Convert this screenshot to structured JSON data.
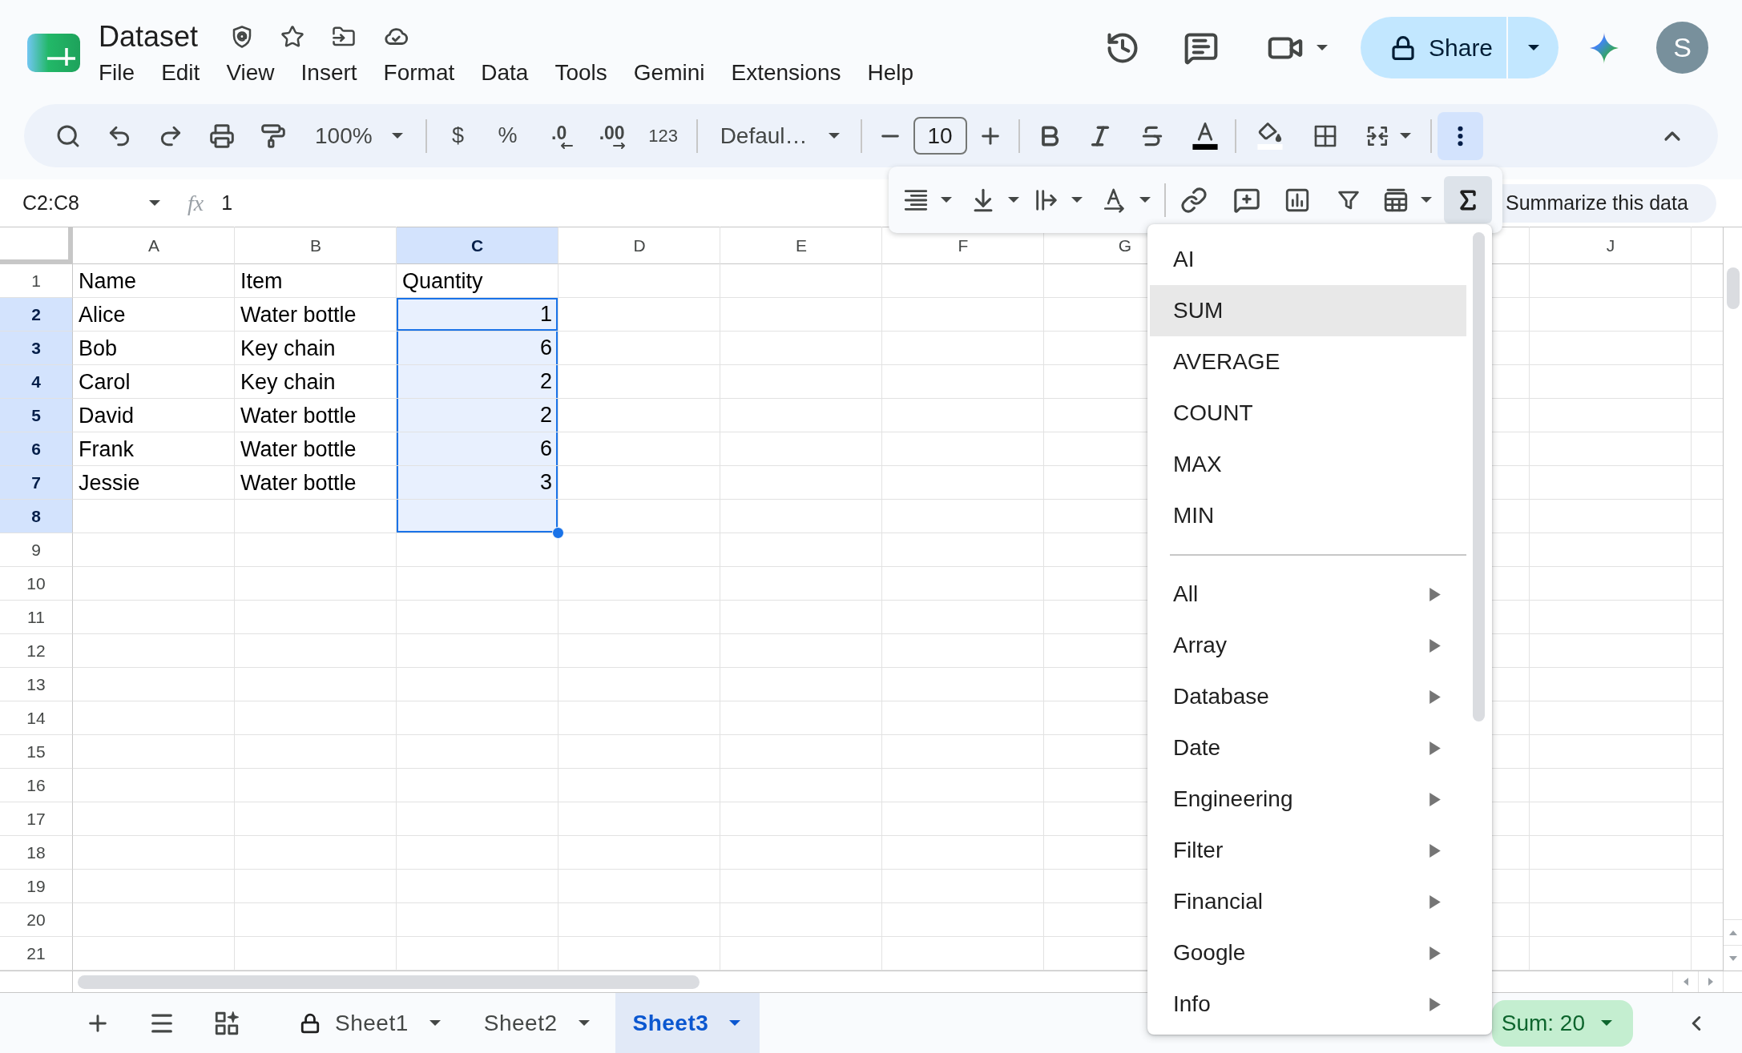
{
  "document": {
    "title": "Dataset"
  },
  "menu_bar": [
    {
      "label": "File"
    },
    {
      "label": "Edit"
    },
    {
      "label": "View"
    },
    {
      "label": "Insert"
    },
    {
      "label": "Format"
    },
    {
      "label": "Data"
    },
    {
      "label": "Tools"
    },
    {
      "label": "Gemini"
    },
    {
      "label": "Extensions"
    },
    {
      "label": "Help"
    }
  ],
  "share": {
    "label": "Share"
  },
  "account": {
    "initial": "S"
  },
  "toolbar": {
    "zoom": "100%",
    "number_formats": [
      {
        "label": "$",
        "kind": "plain"
      },
      {
        "label": "%",
        "kind": "plain"
      },
      {
        "label": ".0",
        "kind": "decrease"
      },
      {
        "label": ".00",
        "kind": "increase"
      },
      {
        "label": "123",
        "kind": "small"
      }
    ],
    "font": "Defaul…",
    "font_size": "10",
    "more_selected": true
  },
  "formula_bar": {
    "name_box": "C2:C8",
    "label": "fx",
    "value": "1"
  },
  "floating_toolbar": {
    "functions_selected": true,
    "suggestion": "Summarize this data"
  },
  "sheet": {
    "columns": [
      {
        "label": "A",
        "selected": false
      },
      {
        "label": "B",
        "selected": false
      },
      {
        "label": "C",
        "selected": true
      },
      {
        "label": "D",
        "selected": false
      },
      {
        "label": "E",
        "selected": false
      },
      {
        "label": "F",
        "selected": false
      },
      {
        "label": "G",
        "selected": false
      }
    ],
    "columns_right": [
      {
        "label": "J",
        "selected": false
      }
    ],
    "rows": [
      {
        "number": "1",
        "selected": false,
        "cells": [
          {
            "text": "Name",
            "kind": "text",
            "selected": false,
            "active": false
          },
          {
            "text": "Item",
            "kind": "text",
            "selected": false,
            "active": false
          },
          {
            "text": "Quantity",
            "kind": "text",
            "selected": false,
            "active": false
          }
        ]
      },
      {
        "number": "2",
        "selected": true,
        "cells": [
          {
            "text": "Alice",
            "kind": "text",
            "selected": false,
            "active": false
          },
          {
            "text": "Water bottle",
            "kind": "text",
            "selected": false,
            "active": false
          },
          {
            "text": "1",
            "kind": "number",
            "selected": true,
            "active": true
          }
        ]
      },
      {
        "number": "3",
        "selected": true,
        "cells": [
          {
            "text": "Bob",
            "kind": "text",
            "selected": false,
            "active": false
          },
          {
            "text": "Key chain",
            "kind": "text",
            "selected": false,
            "active": false
          },
          {
            "text": "6",
            "kind": "number",
            "selected": true,
            "active": false
          }
        ]
      },
      {
        "number": "4",
        "selected": true,
        "cells": [
          {
            "text": "Carol",
            "kind": "text",
            "selected": false,
            "active": false
          },
          {
            "text": "Key chain",
            "kind": "text",
            "selected": false,
            "active": false
          },
          {
            "text": "2",
            "kind": "number",
            "selected": true,
            "active": false
          }
        ]
      },
      {
        "number": "5",
        "selected": true,
        "cells": [
          {
            "text": "David",
            "kind": "text",
            "selected": false,
            "active": false
          },
          {
            "text": "Water bottle",
            "kind": "text",
            "selected": false,
            "active": false
          },
          {
            "text": "2",
            "kind": "number",
            "selected": true,
            "active": false
          }
        ]
      },
      {
        "number": "6",
        "selected": true,
        "cells": [
          {
            "text": "Frank",
            "kind": "text",
            "selected": false,
            "active": false
          },
          {
            "text": "Water bottle",
            "kind": "text",
            "selected": false,
            "active": false
          },
          {
            "text": "6",
            "kind": "number",
            "selected": true,
            "active": false
          }
        ]
      },
      {
        "number": "7",
        "selected": true,
        "cells": [
          {
            "text": "Jessie",
            "kind": "text",
            "selected": false,
            "active": false
          },
          {
            "text": "Water bottle",
            "kind": "text",
            "selected": false,
            "active": false
          },
          {
            "text": "3",
            "kind": "number",
            "selected": true,
            "active": false
          }
        ]
      },
      {
        "number": "8",
        "selected": true,
        "cells": [
          {
            "kind": "empty",
            "selected": false,
            "active": false
          },
          {
            "kind": "empty",
            "selected": false,
            "active": false
          },
          {
            "kind": "empty",
            "selected": true,
            "active": false
          }
        ]
      },
      {
        "number": "9",
        "selected": false
      },
      {
        "number": "10",
        "selected": false
      },
      {
        "number": "11",
        "selected": false
      },
      {
        "number": "12",
        "selected": false
      },
      {
        "number": "13",
        "selected": false
      },
      {
        "number": "14",
        "selected": false
      },
      {
        "number": "15",
        "selected": false
      },
      {
        "number": "16",
        "selected": false
      },
      {
        "number": "17",
        "selected": false
      },
      {
        "number": "18",
        "selected": false
      },
      {
        "number": "19",
        "selected": false
      },
      {
        "number": "20",
        "selected": false
      },
      {
        "number": "21",
        "selected": false
      }
    ]
  },
  "function_menu": {
    "items": [
      {
        "label": "AI",
        "kind": "function",
        "selected": false
      },
      {
        "label": "SUM",
        "kind": "function",
        "selected": true
      },
      {
        "label": "AVERAGE",
        "kind": "function",
        "selected": false
      },
      {
        "label": "COUNT",
        "kind": "function",
        "selected": false
      },
      {
        "label": "MAX",
        "kind": "function",
        "selected": false
      },
      {
        "label": "MIN",
        "kind": "function",
        "selected": false
      },
      {
        "label": "All",
        "kind": "category",
        "selected": false
      },
      {
        "label": "Array",
        "kind": "category",
        "selected": false
      },
      {
        "label": "Database",
        "kind": "category",
        "selected": false
      },
      {
        "label": "Date",
        "kind": "category",
        "selected": false
      },
      {
        "label": "Engineering",
        "kind": "category",
        "selected": false
      },
      {
        "label": "Filter",
        "kind": "category",
        "selected": false
      },
      {
        "label": "Financial",
        "kind": "category",
        "selected": false
      },
      {
        "label": "Google",
        "kind": "category",
        "selected": false
      },
      {
        "label": "Info",
        "kind": "category",
        "selected": false
      }
    ]
  },
  "sheet_tabs": [
    {
      "label": "Sheet1",
      "locked": true,
      "selected": false
    },
    {
      "label": "Sheet2",
      "locked": false,
      "selected": false
    },
    {
      "label": "Sheet3",
      "locked": false,
      "selected": true
    }
  ],
  "status": {
    "summary": "Sum: 20"
  }
}
